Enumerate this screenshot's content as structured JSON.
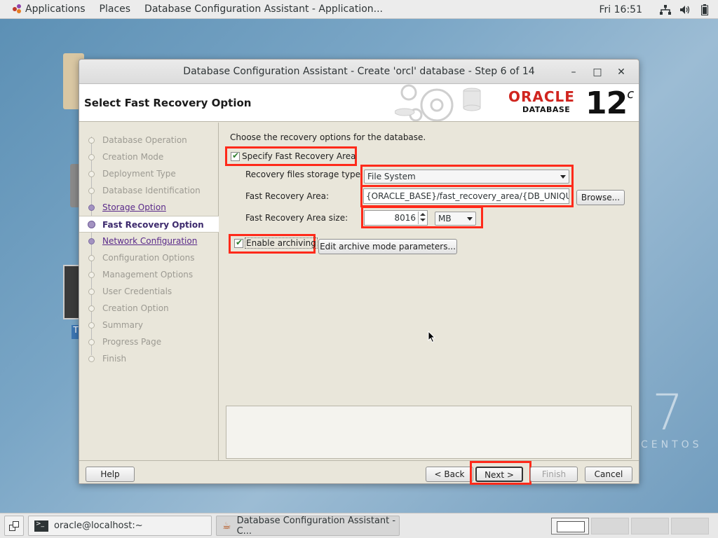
{
  "topbar": {
    "applications": "Applications",
    "places": "Places",
    "window_title": "Database Configuration Assistant - Application...",
    "clock": "Fri 16:51",
    "icons": [
      "network-icon",
      "volume-icon",
      "battery-icon"
    ]
  },
  "dialog": {
    "title": "Database Configuration Assistant - Create 'orcl' database - Step 6 of 14",
    "page_title": "Select Fast Recovery Option",
    "logo": {
      "brand": "ORACLE",
      "product": "DATABASE",
      "version": "12",
      "version_suffix": "c"
    },
    "steps": [
      {
        "label": "Database Operation",
        "state": "disabled"
      },
      {
        "label": "Creation Mode",
        "state": "disabled"
      },
      {
        "label": "Deployment Type",
        "state": "disabled"
      },
      {
        "label": "Database Identification",
        "state": "disabled"
      },
      {
        "label": "Storage Option",
        "state": "link"
      },
      {
        "label": "Fast Recovery Option",
        "state": "current"
      },
      {
        "label": "Network Configuration",
        "state": "link"
      },
      {
        "label": "Configuration Options",
        "state": "disabled"
      },
      {
        "label": "Management Options",
        "state": "disabled"
      },
      {
        "label": "User Credentials",
        "state": "disabled"
      },
      {
        "label": "Creation Option",
        "state": "disabled"
      },
      {
        "label": "Summary",
        "state": "disabled"
      },
      {
        "label": "Progress Page",
        "state": "disabled"
      },
      {
        "label": "Finish",
        "state": "disabled"
      }
    ],
    "content": {
      "intro": "Choose the recovery options for the database.",
      "specify_fra_label": "Specify Fast Recovery Area",
      "specify_fra_checked": true,
      "storage_type_label": "Recovery files storage type:",
      "storage_type_value": "File System",
      "fra_label": "Fast Recovery Area:",
      "fra_value": "{ORACLE_BASE}/fast_recovery_area/{DB_UNIQUE_",
      "browse_label": "Browse...",
      "fra_size_label": "Fast Recovery Area size:",
      "fra_size_value": "8016",
      "fra_size_unit": "MB",
      "enable_archiving_label": "Enable archiving",
      "enable_archiving_checked": true,
      "edit_archive_label": "Edit archive mode parameters..."
    },
    "buttons": {
      "help": "Help",
      "back": "< Back",
      "next": "Next >",
      "finish": "Finish",
      "cancel": "Cancel"
    }
  },
  "desktop": {
    "centos_version": "7",
    "centos_text": "CENTOS"
  },
  "taskbar": {
    "tasks": [
      "oracle@localhost:~",
      "Database Configuration Assistant - C..."
    ]
  },
  "colors": {
    "highlight": "#ff2a1a",
    "oracle_red": "#d0251f",
    "link_purple": "#5a2a8a"
  }
}
